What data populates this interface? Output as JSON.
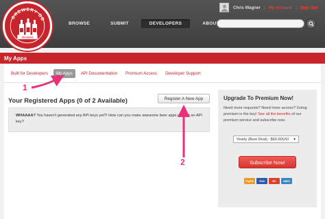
{
  "logo": {
    "text": "BREWERY DB",
    "tagline": "Steadfast"
  },
  "nav": {
    "items": [
      "BROWSE",
      "SUBMIT",
      "DEVELOPERS",
      "ABOUT"
    ],
    "active_index": 2
  },
  "user": {
    "name": "Chris Wagner",
    "account_label": "My Account",
    "signout_label": "Sign Out",
    "separator": "::"
  },
  "search": {
    "placeholder": ""
  },
  "page": {
    "title": "My Apps"
  },
  "tabs": [
    "Built for Developers",
    "My Apps",
    "API Documentation",
    "Premium Access",
    "Developer Support"
  ],
  "apps": {
    "heading": "Your Registered Apps (0 of 2 Available)",
    "register_label": "Register A New App",
    "notice_strong": "WHAAAA?",
    "notice_text": " You haven't generated any API keys yet?! How can you make awesome beer apps without an API key?"
  },
  "upgrade": {
    "title": "Upgrade To Premium Now!",
    "text_1": "Need more requests? Need more access? Going premium is the key!",
    "link": "See all the benefits",
    "text_2": "of our premium service and subscribe now.",
    "plan_value": "Yearly (Best Deal) : $60.00USI",
    "subscribe_label": "Subscribe Now!",
    "cards": [
      {
        "name": "PayPal",
        "color": "#e89b2c"
      },
      {
        "name": "VISA",
        "color": "#2a5caa"
      },
      {
        "name": "MC",
        "color": "#d9412b"
      },
      {
        "name": "AMEX",
        "color": "#3d86c6"
      }
    ]
  },
  "annotations": {
    "label_1": "1",
    "label_2": "2",
    "color": "#e8317a"
  }
}
